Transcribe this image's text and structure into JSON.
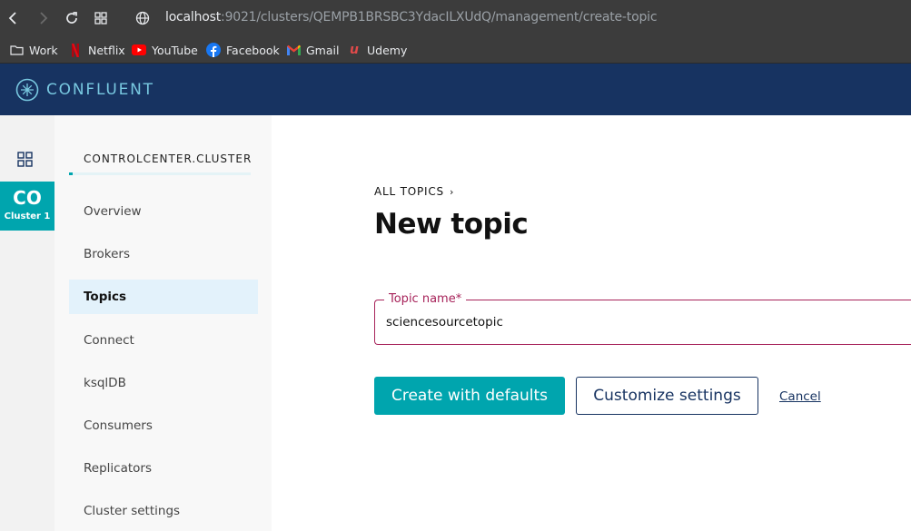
{
  "browser": {
    "url_host": "localhost",
    "url_rest": ":9021/clusters/QEMPB1BRSBC3YdacILXUdQ/management/create-topic",
    "bookmarks": [
      {
        "label": "Work"
      },
      {
        "label": "Netflix"
      },
      {
        "label": "YouTube"
      },
      {
        "label": "Facebook"
      },
      {
        "label": "Gmail"
      },
      {
        "label": "Udemy"
      }
    ]
  },
  "header": {
    "logo_text": "CONFLUENT"
  },
  "rail": {
    "cluster_abbr": "CO",
    "cluster_name": "Cluster 1"
  },
  "sidebar": {
    "title": "CONTROLCENTER.CLUSTER",
    "items": [
      {
        "label": "Overview"
      },
      {
        "label": "Brokers"
      },
      {
        "label": "Topics",
        "active": true
      },
      {
        "label": "Connect"
      },
      {
        "label": "ksqlDB"
      },
      {
        "label": "Consumers"
      },
      {
        "label": "Replicators"
      },
      {
        "label": "Cluster settings"
      }
    ]
  },
  "main": {
    "breadcrumb": "ALL TOPICS",
    "title": "New topic",
    "topic_field": {
      "label": "Topic name*",
      "value": "sciencesourcetopic"
    },
    "create_button": "Create with defaults",
    "customize_button": "Customize settings",
    "cancel_link": "Cancel"
  },
  "colors": {
    "header_bg": "#173361",
    "accent": "#00a5ae",
    "field_border": "#a7235a",
    "active_nav_bg": "#e3f2fb"
  }
}
